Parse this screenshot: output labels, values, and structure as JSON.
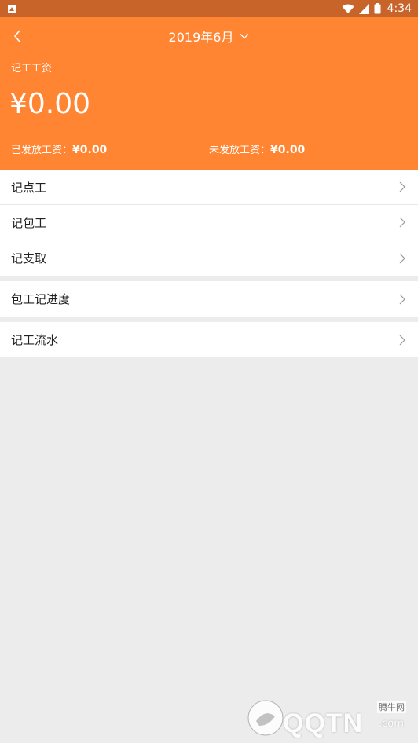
{
  "status_bar": {
    "time": "4:34"
  },
  "header": {
    "month": "2019年6月",
    "title": "记工工资",
    "total": "¥0.00",
    "paid_label": "已发放工资：",
    "paid_value": "¥0.00",
    "unpaid_label": "未发放工资：",
    "unpaid_value": "¥0.00"
  },
  "menu": {
    "group1": [
      {
        "label": "记点工"
      },
      {
        "label": "记包工"
      },
      {
        "label": "记支取"
      }
    ],
    "group2": [
      {
        "label": "包工记进度"
      }
    ],
    "group3": [
      {
        "label": "记工流水"
      }
    ]
  },
  "watermark": {
    "brand": "QQTN",
    "site_cn": "腾牛网",
    "suffix": ".com"
  },
  "colors": {
    "header": "#ff8533",
    "status_bar": "#c8642a",
    "background": "#ececec"
  }
}
